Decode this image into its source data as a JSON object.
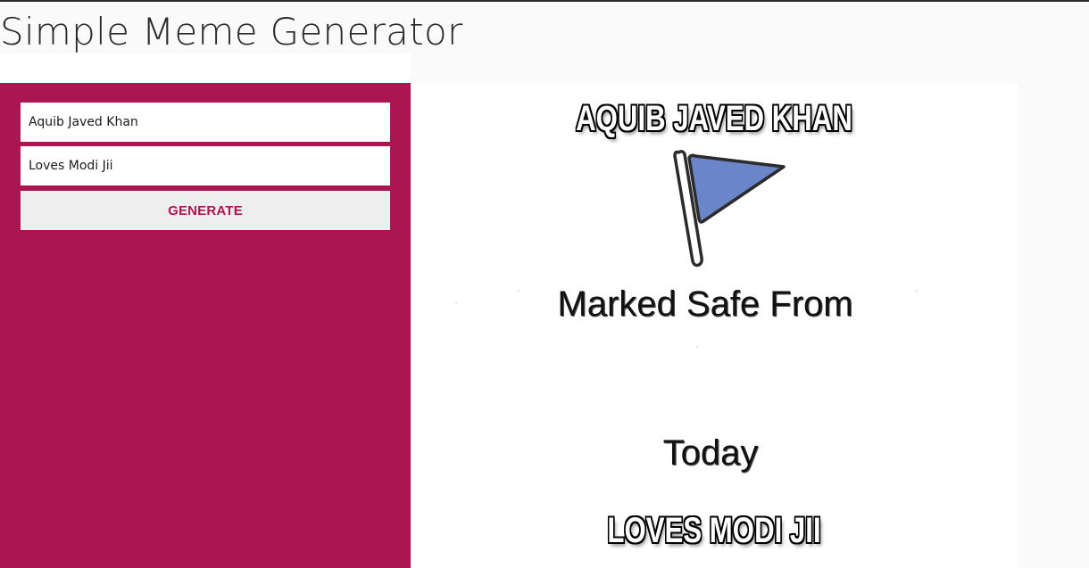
{
  "app": {
    "title": "Simple Meme Generator"
  },
  "form": {
    "top_text_value": "Aquib Javed Khan",
    "bottom_text_value": "Loves Modi Jii",
    "generate_label": "GENERATE"
  },
  "meme": {
    "top_caption": "AQUIB JAVED KHAN",
    "bottom_caption": "LOVES MODI JII",
    "image_text_line1": "Marked Safe From",
    "image_text_line2": "Today",
    "image_icon": "flag-icon"
  },
  "colors": {
    "panel": "#ab1552",
    "button_bg": "#eeeeee",
    "button_text": "#ab1552",
    "flag": "#6a86c8"
  }
}
